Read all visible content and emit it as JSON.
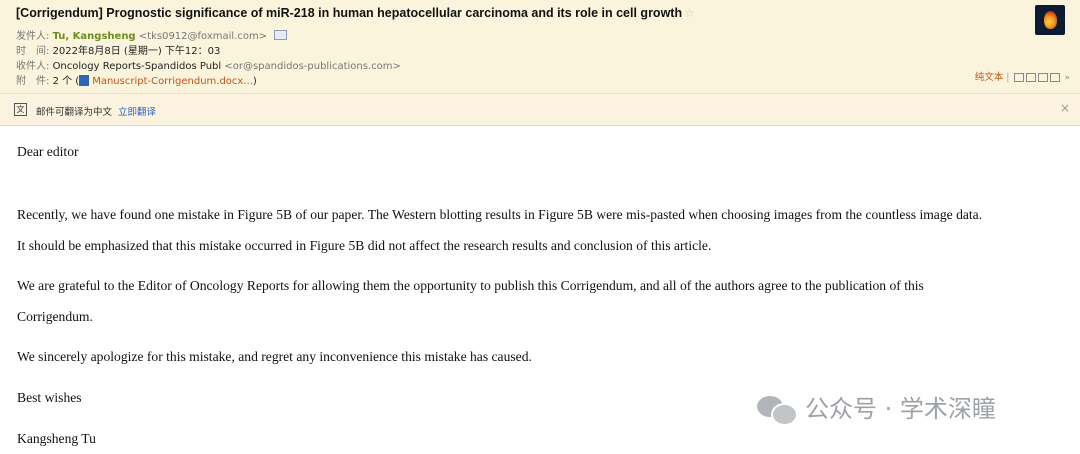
{
  "header": {
    "subject": "[Corrigendum] Prognostic significance of miR-218 in human hepatocellular carcinoma and its role in cell growth",
    "star_icon": "star-outline-icon",
    "from_label": "发件人:",
    "from_name": "Tu, Kangsheng",
    "from_email": "<tks0912@foxmail.com>",
    "time_label": "时　间:",
    "time_value": "2022年8月8日 (星期一) 下午12：03",
    "to_label": "收件人:",
    "to_name": "Oncology Reports-Spandidos Publ",
    "to_email": "<or@spandidos-publications.com>",
    "attach_label": "附　件:",
    "attach_count": "2 个 (",
    "attach_file": "Manuscript-Corrigendum.docx...",
    "attach_close": ")",
    "plain_text_label": "纯文本"
  },
  "translate_bar": {
    "icon_glyph": "文",
    "text": "邮件可翻译为中文",
    "link": "立即翻译",
    "close": "×"
  },
  "body": {
    "greeting": "Dear editor",
    "p1_line1": "Recently, we have found one mistake in Figure 5B of our paper. The Western blotting results in Figure 5B were mis-pasted when choosing images from the countless image data.",
    "p1_line2": "It should be emphasized that this mistake occurred in Figure 5B did not affect the research results and conclusion of this article.",
    "p2_line1": "We are grateful to the Editor of Oncology Reports for allowing them the opportunity to publish this Corrigendum, and all of the authors agree to the publication of this",
    "p2_line2": "Corrigendum.",
    "p3": "We sincerely apologize for this mistake, and regret any inconvenience this mistake has caused.",
    "closing": "Best wishes",
    "signature": "Kangsheng Tu"
  },
  "watermark": {
    "text": "公众号 · 学术深瞳"
  }
}
